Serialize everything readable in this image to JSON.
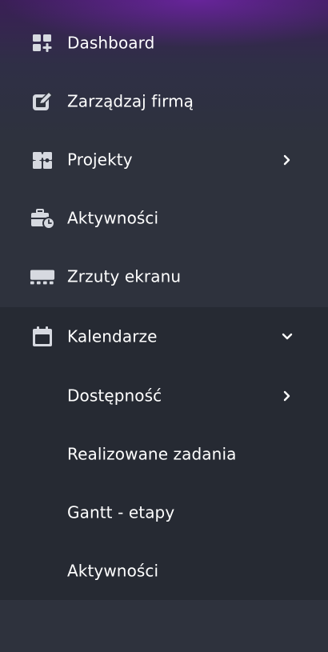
{
  "menu": [
    {
      "label": "Dashboard",
      "icon": "dashboard-icon"
    },
    {
      "label": "Zarządzaj firmą",
      "icon": "edit-icon"
    },
    {
      "label": "Projekty",
      "icon": "puzzle-icon",
      "chevron": "right"
    },
    {
      "label": "Aktywności",
      "icon": "briefcase-clock-icon"
    },
    {
      "label": "Zrzuty ekranu",
      "icon": "screen-icon"
    },
    {
      "label": "Kalendarze",
      "icon": "calendar-icon",
      "chevron": "down",
      "expanded": true
    }
  ],
  "submenu": [
    {
      "label": "Dostępność",
      "chevron": "right"
    },
    {
      "label": "Realizowane zadania"
    },
    {
      "label": "Gantt - etapy"
    },
    {
      "label": "Aktywności"
    }
  ],
  "colors": {
    "text": "#ffffff",
    "icon": "#d6d9e0",
    "background": "#2e323d",
    "submenu_background": "#262a33",
    "top_glow": "#8c28d2"
  }
}
